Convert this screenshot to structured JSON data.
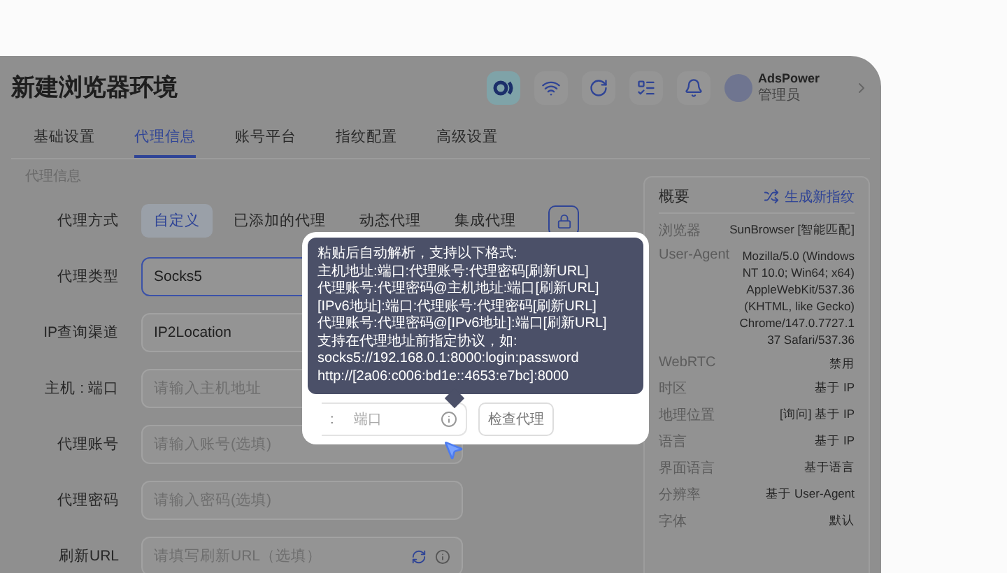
{
  "header": {
    "title": "新建浏览器环境",
    "user": {
      "name": "AdsPower",
      "role": "管理员"
    }
  },
  "tabs": [
    {
      "label": "基础设置",
      "selected": false
    },
    {
      "label": "代理信息",
      "selected": true
    },
    {
      "label": "账号平台",
      "selected": false
    },
    {
      "label": "指纹配置",
      "selected": false
    },
    {
      "label": "高级设置",
      "selected": false
    }
  ],
  "section_label": "代理信息",
  "proxy_mode": {
    "label": "代理方式",
    "options": [
      {
        "label": "自定义",
        "selected": true
      },
      {
        "label": "已添加的代理",
        "selected": false
      },
      {
        "label": "动态代理",
        "selected": false
      },
      {
        "label": "集成代理",
        "selected": false
      }
    ]
  },
  "fields": [
    {
      "label": "代理类型",
      "value": "Socks5",
      "focused": true
    },
    {
      "label": "IP查询渠道",
      "value": "IP2Location",
      "focused": false
    },
    {
      "label": "主机 : 端口",
      "placeholder": "请输入主机地址",
      "focused": false
    },
    {
      "label": "代理账号",
      "placeholder": "请输入账号(选填)",
      "focused": false
    },
    {
      "label": "代理密码",
      "placeholder": "请输入密码(选填)",
      "focused": false
    },
    {
      "label": "刷新URL",
      "placeholder": "请填写刷新URL（选填）",
      "focused": false
    }
  ],
  "spotlight": {
    "tooltip_lines": [
      "粘贴后自动解析，支持以下格式:",
      "主机地址:端口:代理账号:代理密码[刷新URL]",
      "代理账号:代理密码@主机地址:端口[刷新URL]",
      "[IPv6地址]:端口:代理账号:代理密码[刷新URL]",
      "代理账号:代理密码@[IPv6地址]:端口[刷新URL]",
      "支持在代理地址前指定协议，如:",
      "socks5://192.168.0.1:8000:login:password",
      "http://[2a06:c006:bd1e::4653:e7bc]:8000"
    ],
    "separator": ":",
    "port_placeholder": "端口",
    "check_button": "检查代理"
  },
  "summary": {
    "title": "概要",
    "action": "生成新指纹",
    "rows": [
      {
        "label": "浏览器",
        "value": "SunBrowser [智能匹配]"
      },
      {
        "label": "User-Agent",
        "value": "Mozilla/5.0 (Windows NT 10.0; Win64; x64) AppleWebKit/537.36 (KHTML, like Gecko) Chrome/147.0.7727.137 Safari/537.36"
      },
      {
        "label": "WebRTC",
        "value": "禁用"
      },
      {
        "label": "时区",
        "value": "基于 IP"
      },
      {
        "label": "地理位置",
        "value": "[询问] 基于 IP"
      },
      {
        "label": "语言",
        "value": "基于 IP"
      },
      {
        "label": "界面语言",
        "value": "基于语言"
      },
      {
        "label": "分辨率",
        "value": "基于 User-Agent"
      },
      {
        "label": "字体",
        "value": "默认"
      }
    ]
  }
}
